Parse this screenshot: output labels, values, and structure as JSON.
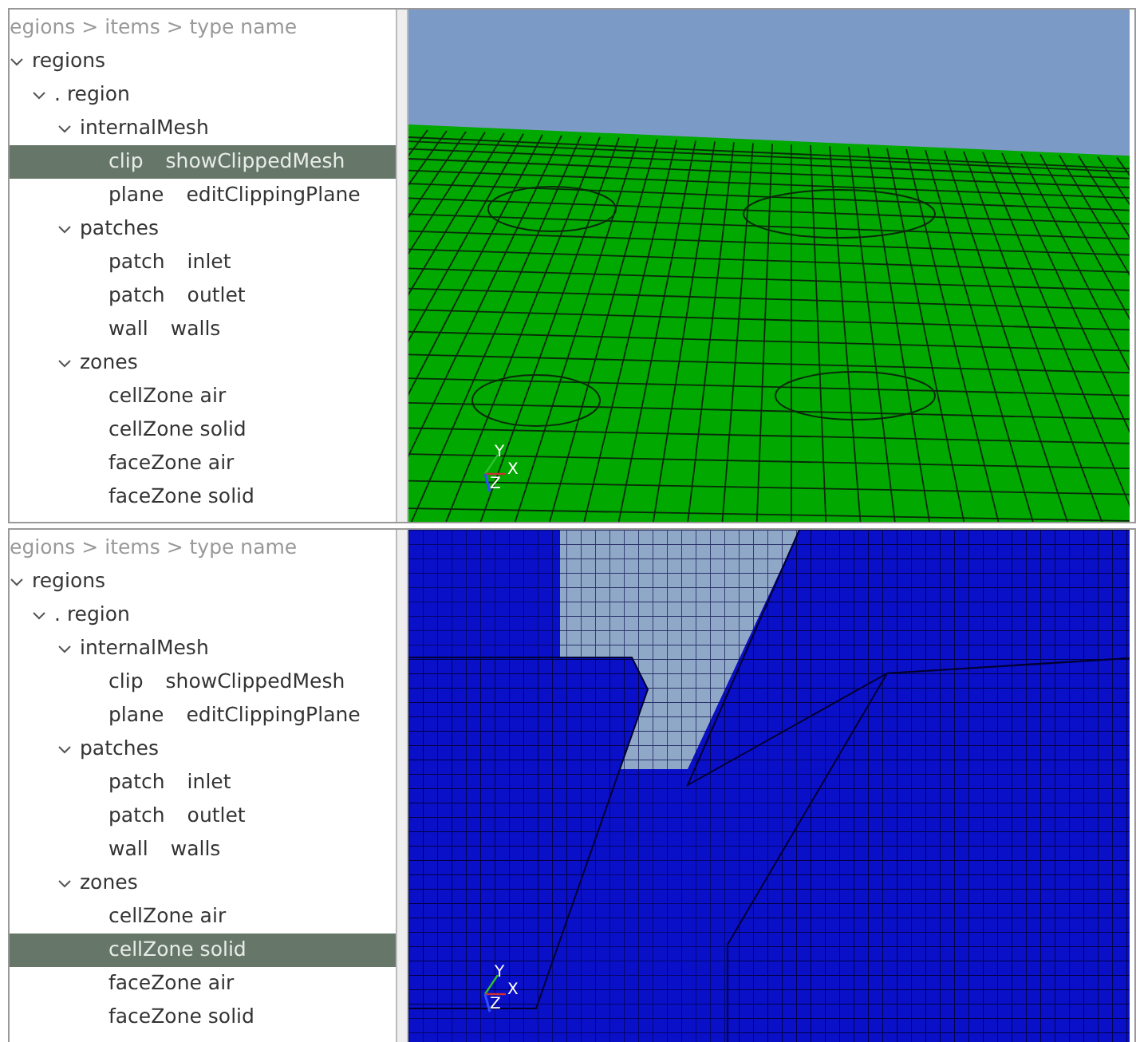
{
  "panels": [
    {
      "breadcrumb": "egions > items > type name",
      "kind": "surface",
      "color": "#00a800",
      "axes": [
        "Y",
        "X",
        "Z"
      ],
      "tree": [
        {
          "label": "regions",
          "expanded": true,
          "selected": false,
          "children": [
            {
              "label": ". region",
              "expanded": true,
              "selected": false,
              "children": [
                {
                  "label": "internalMesh",
                  "expanded": true,
                  "selected": false,
                  "children": [
                    {
                      "type": "clip",
                      "name": "showClippedMesh",
                      "selected": true
                    },
                    {
                      "type": "plane",
                      "name": "editClippingPlane",
                      "selected": false
                    }
                  ]
                },
                {
                  "label": "patches",
                  "expanded": true,
                  "selected": false,
                  "children": [
                    {
                      "type": "patch",
                      "name": "inlet",
                      "selected": false
                    },
                    {
                      "type": "patch",
                      "name": "outlet",
                      "selected": false
                    },
                    {
                      "type": "wall",
                      "name": "walls",
                      "selected": false
                    }
                  ]
                },
                {
                  "label": "zones",
                  "expanded": true,
                  "selected": false,
                  "children": [
                    {
                      "label": "cellZone air",
                      "selected": false
                    },
                    {
                      "label": "cellZone solid",
                      "selected": false
                    },
                    {
                      "label": "faceZone air",
                      "selected": false
                    },
                    {
                      "label": "faceZone solid",
                      "selected": false
                    }
                  ]
                }
              ]
            }
          ]
        }
      ]
    },
    {
      "breadcrumb": "egions > items > type name",
      "kind": "blocks",
      "color": "#0a10c8",
      "axes": [
        "Y",
        "X",
        "Z"
      ],
      "tree": [
        {
          "label": "regions",
          "expanded": true,
          "selected": false,
          "children": [
            {
              "label": ". region",
              "expanded": true,
              "selected": false,
              "children": [
                {
                  "label": "internalMesh",
                  "expanded": true,
                  "selected": false,
                  "children": [
                    {
                      "type": "clip",
                      "name": "showClippedMesh",
                      "selected": false
                    },
                    {
                      "type": "plane",
                      "name": "editClippingPlane",
                      "selected": false
                    }
                  ]
                },
                {
                  "label": "patches",
                  "expanded": true,
                  "selected": false,
                  "children": [
                    {
                      "type": "patch",
                      "name": "inlet",
                      "selected": false
                    },
                    {
                      "type": "patch",
                      "name": "outlet",
                      "selected": false
                    },
                    {
                      "type": "wall",
                      "name": "walls",
                      "selected": false
                    }
                  ]
                },
                {
                  "label": "zones",
                  "expanded": true,
                  "selected": false,
                  "children": [
                    {
                      "label": "cellZone air",
                      "selected": false
                    },
                    {
                      "label": "cellZone solid",
                      "selected": true
                    },
                    {
                      "label": "faceZone air",
                      "selected": false
                    },
                    {
                      "label": "faceZone solid",
                      "selected": false
                    }
                  ]
                }
              ]
            }
          ]
        }
      ]
    }
  ]
}
